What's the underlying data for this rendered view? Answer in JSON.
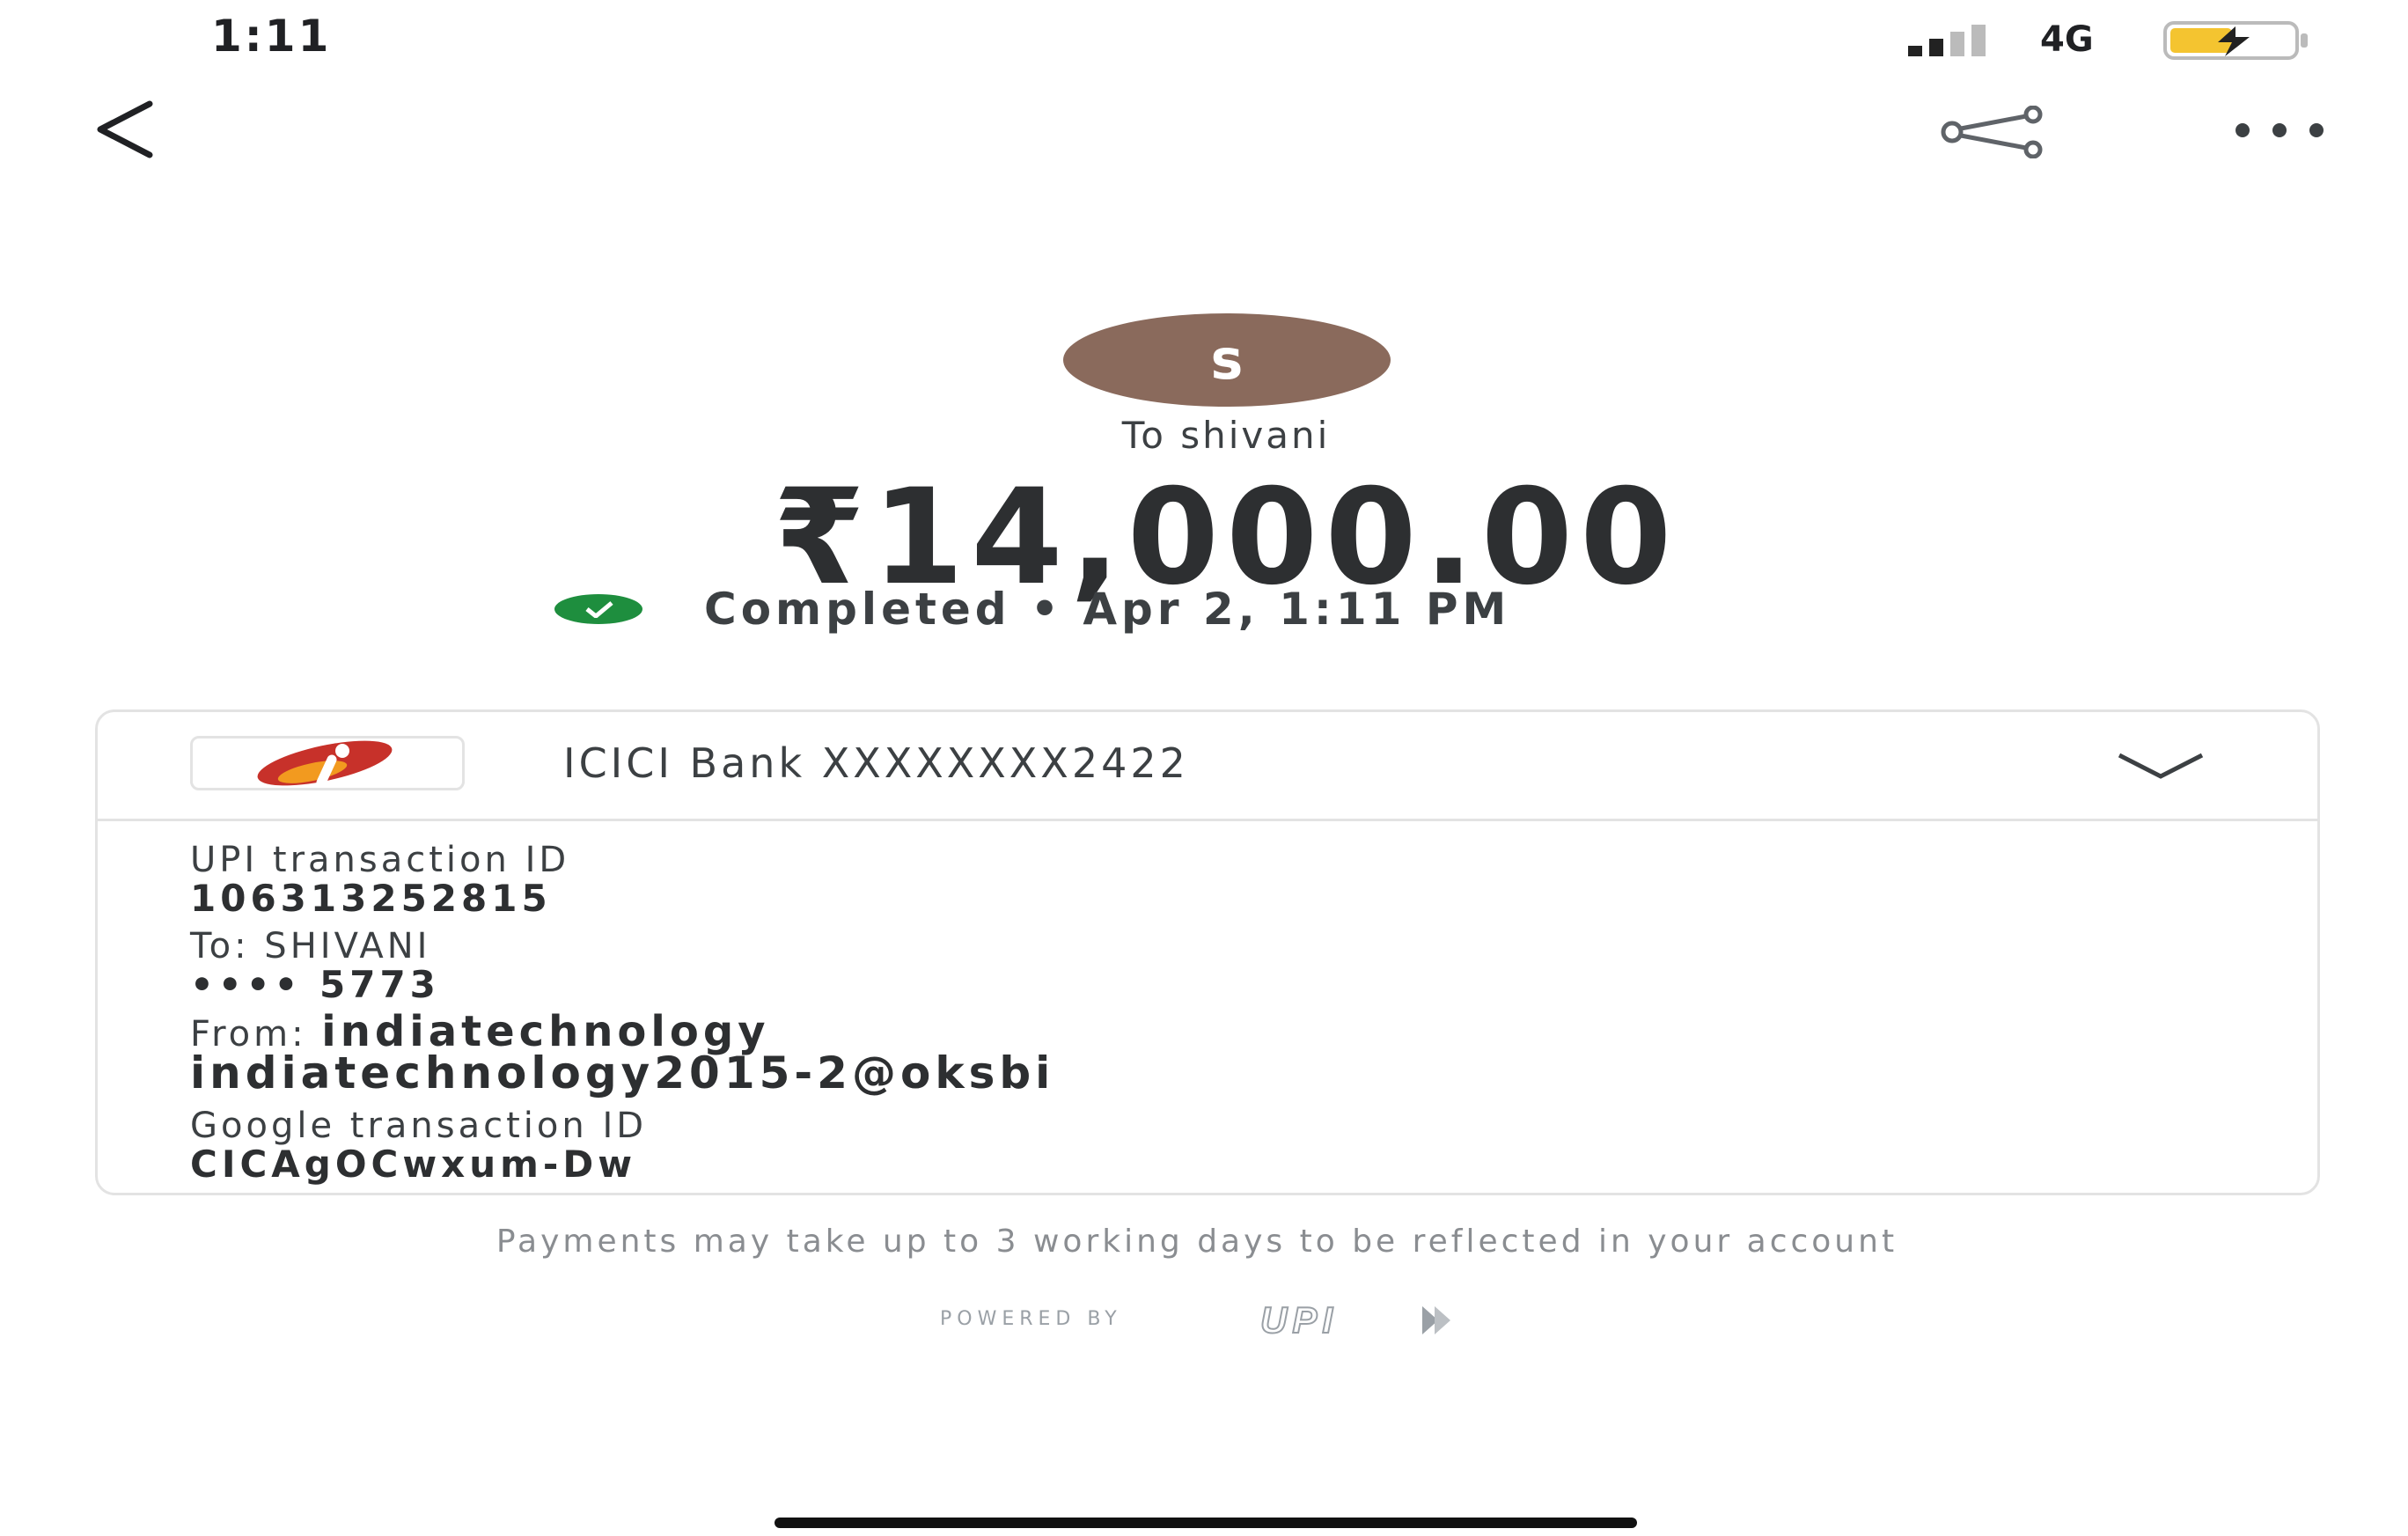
{
  "status_bar": {
    "time": "1:11",
    "network": "4G"
  },
  "header": {
    "back_icon": "chevron-left-icon",
    "share_icon": "share-icon",
    "more_icon": "more-horizontal-icon"
  },
  "payee": {
    "avatar_letter": "s",
    "to_label": "To shivani"
  },
  "payment": {
    "amount": "₹14,000.00",
    "status_text": "Completed • Apr 2, 1:11 PM",
    "status_color": "#1e8e3e"
  },
  "card": {
    "bank_name": "ICICI Bank XXXXXXXX2422",
    "rows": {
      "upi_id_label": "UPI transaction ID",
      "upi_id_value": "106313252815",
      "to_label": "To: SHIVANI",
      "to_value": "•••• 5773",
      "from_label": "From: ",
      "from_name": "indiatechnology",
      "from_vpa": "indiatechnology2015-2@oksbi",
      "google_id_label": "Google transaction ID",
      "google_id_value": "CICAgOCwxum-Dw"
    }
  },
  "footer": {
    "note": "Payments may take up to 3 working days to be reflected in your account",
    "powered_by": "POWERED BY",
    "upi_logo_text": "UPI"
  }
}
